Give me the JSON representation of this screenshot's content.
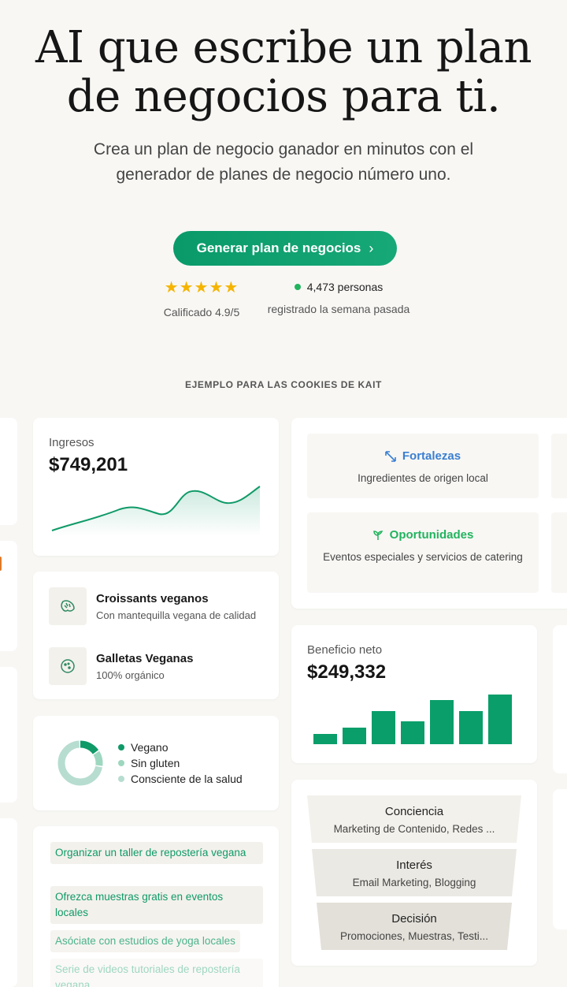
{
  "hero": {
    "title_line1": "AI que escribe un plan",
    "title_line2": "de negocios para ti.",
    "subtitle": "Crea un plan de negocio ganador en minutos con el generador de planes de negocio número uno.",
    "cta_label": "Generar plan de negocios",
    "cta_chevron": "›"
  },
  "rating": {
    "stars": "★★★★★",
    "label": "Calificado 4.9/5"
  },
  "registered": {
    "count": "4,473 personas",
    "label": "registrado la semana pasada"
  },
  "example_label": "EJEMPLO PARA LAS COOKIES DE KAIT",
  "revenue": {
    "label": "Ingresos",
    "value": "$749,201"
  },
  "products": [
    {
      "title": "Croissants veganos",
      "desc": "Con mantequilla vegana de calidad",
      "icon": "croissant-icon"
    },
    {
      "title": "Galletas Veganas",
      "desc": "100% orgánico",
      "icon": "cookie-icon"
    }
  ],
  "segments": {
    "items": [
      {
        "label": "Vegano",
        "color": "#0f9a68",
        "share": 0.16
      },
      {
        "label": "Sin gluten",
        "color": "#9ed7c0",
        "share": 0.12
      },
      {
        "label": "Consciente de la salud",
        "color": "#b7ddd0",
        "share": 0.72
      }
    ]
  },
  "tasks": [
    {
      "text": "Organizar un taller de repostería vegana"
    },
    {
      "text": "Ofrezca muestras gratis en eventos locales"
    },
    {
      "text": "Asóciate con estudios de yoga locales"
    },
    {
      "text": "Serie de videos tutoriales de repostería vegana"
    }
  ],
  "swot": {
    "strengths": {
      "title": "Fortalezas",
      "desc": "Ingredientes de origen local",
      "color": "#3b7fd1",
      "icon": "expand-arrows-icon"
    },
    "opportunities": {
      "title": "Oportunidades",
      "desc": "Eventos especiales y servicios de catering",
      "color": "#22b35f",
      "icon": "sprout-icon"
    }
  },
  "net_profit": {
    "label": "Beneficio neto",
    "value": "$249,332"
  },
  "funnel": [
    {
      "title": "Conciencia",
      "desc": "Marketing de Contenido, Redes ..."
    },
    {
      "title": "Interés",
      "desc": "Email Marketing, Blogging"
    },
    {
      "title": "Decisión",
      "desc": "Promociones, Muestras, Testi..."
    }
  ],
  "colors": {
    "brand": "#0f9a68",
    "bar": "#0a9e6a",
    "background": "#f8f7f4"
  }
}
